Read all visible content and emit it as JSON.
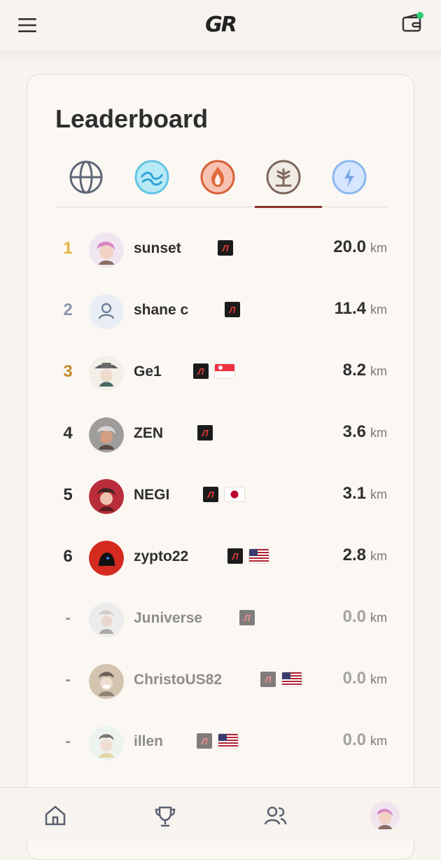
{
  "topbar": {
    "logo_text": "GR",
    "icons": [
      "menu-icon",
      "wallet-icon"
    ]
  },
  "leaderboard": {
    "title": "Leaderboard",
    "tabs": [
      {
        "icon": "globe-icon"
      },
      {
        "icon": "wave-icon"
      },
      {
        "icon": "flame-icon"
      },
      {
        "icon": "tree-icon",
        "selected": true
      },
      {
        "icon": "lightning-icon"
      }
    ],
    "rows": [
      {
        "rank": "1",
        "name": "sunset",
        "distance": "20.0",
        "unit": "km",
        "flags": [],
        "rank_color": "#e3b342"
      },
      {
        "rank": "2",
        "name": "shane c",
        "distance": "11.4",
        "unit": "km",
        "flags": [],
        "rank_color": "#8a95ad"
      },
      {
        "rank": "3",
        "name": "Ge1",
        "distance": "8.2",
        "unit": "km",
        "flags": [
          "Singapore"
        ],
        "rank_color": "#c48d2c"
      },
      {
        "rank": "4",
        "name": "ZEN",
        "distance": "3.6",
        "unit": "km",
        "flags": []
      },
      {
        "rank": "5",
        "name": "NEGI",
        "distance": "3.1",
        "unit": "km",
        "flags": [
          "Japan"
        ]
      },
      {
        "rank": "6",
        "name": "zypto22",
        "distance": "2.8",
        "unit": "km",
        "flags": [
          "United States"
        ]
      },
      {
        "rank": "-",
        "name": "Juniverse",
        "distance": "0.0",
        "unit": "km",
        "flags": []
      },
      {
        "rank": "-",
        "name": "ChristoUS82",
        "distance": "0.0",
        "unit": "km",
        "flags": [
          "United States"
        ]
      },
      {
        "rank": "-",
        "name": "illen",
        "distance": "0.0",
        "unit": "km",
        "flags": [
          "United States"
        ]
      }
    ]
  },
  "bottom_nav": {
    "icons": [
      "home-icon",
      "trophy-icon",
      "friends-icon",
      "profile-avatar"
    ]
  }
}
